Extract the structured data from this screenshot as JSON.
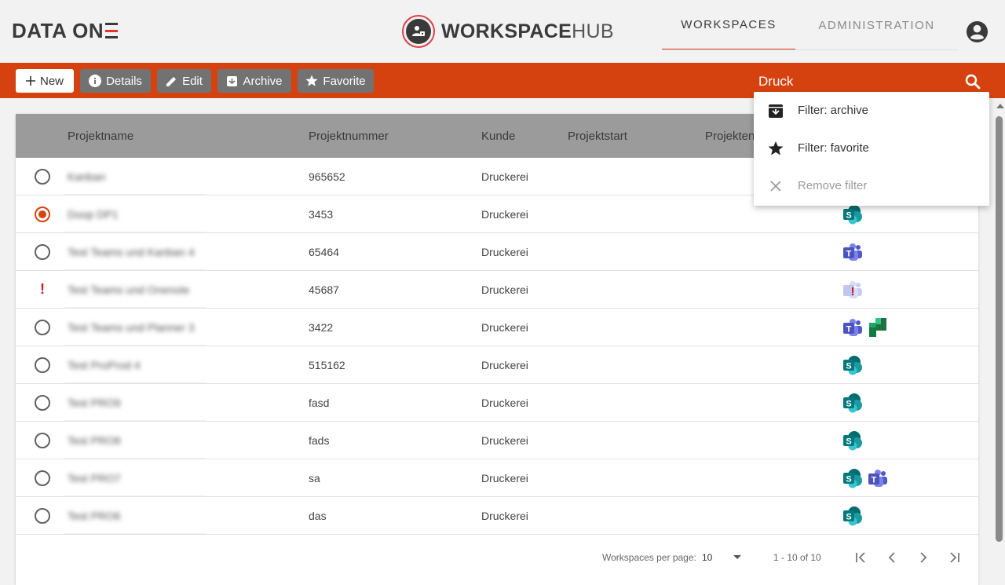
{
  "header": {
    "brand": "DATA ON",
    "logo_text": "WORKSPACE",
    "logo_text_hub": "HUB",
    "nav_tabs": [
      {
        "label": "WORKSPACES",
        "active": true
      },
      {
        "label": "ADMINISTRATION",
        "active": false
      }
    ]
  },
  "toolbar": {
    "new_label": "New",
    "details_label": "Details",
    "edit_label": "Edit",
    "archive_label": "Archive",
    "favorite_label": "Favorite",
    "search_value": "Druck"
  },
  "dropdown": {
    "items": [
      {
        "label": "Filter: archive",
        "icon": "archive-icon"
      },
      {
        "label": "Filter: favorite",
        "icon": "star-icon"
      },
      {
        "label": "Remove filter",
        "icon": "close-icon",
        "disabled": true
      }
    ]
  },
  "table": {
    "headers": [
      "Projektname",
      "Projektnummer",
      "Kunde",
      "Projektstart",
      "Projektende"
    ],
    "rows": [
      {
        "name": "Kanban",
        "number": "965652",
        "customer": "Druckerei",
        "state": "unselected",
        "apps": []
      },
      {
        "name": "Doop DP1",
        "number": "3453",
        "customer": "Druckerei",
        "state": "selected",
        "apps": [
          "sharepoint-icon"
        ]
      },
      {
        "name": "Test Teams und Kanban 4",
        "number": "65464",
        "customer": "Druckerei",
        "state": "unselected",
        "apps": [
          "teams-icon"
        ]
      },
      {
        "name": "Test Teams und Onenote",
        "number": "45687",
        "customer": "Druckerei",
        "state": "warning",
        "apps": [
          "teams-warning-icon"
        ]
      },
      {
        "name": "Test Teams und Planner 3",
        "number": "3422",
        "customer": "Druckerei",
        "state": "unselected",
        "apps": [
          "teams-icon",
          "planner-icon"
        ]
      },
      {
        "name": "Test ProProd 4",
        "number": "515162",
        "customer": "Druckerei",
        "state": "unselected",
        "apps": [
          "sharepoint-icon"
        ]
      },
      {
        "name": "Test PRO9",
        "number": "fasd",
        "customer": "Druckerei",
        "state": "unselected",
        "apps": [
          "sharepoint-icon"
        ]
      },
      {
        "name": "Test PRO8",
        "number": "fads",
        "customer": "Druckerei",
        "state": "unselected",
        "apps": [
          "sharepoint-icon"
        ]
      },
      {
        "name": "Test PRO7",
        "number": "sa",
        "customer": "Druckerei",
        "state": "unselected",
        "apps": [
          "sharepoint-icon",
          "teams-icon"
        ]
      },
      {
        "name": "Test PRO6",
        "number": "das",
        "customer": "Druckerei",
        "state": "unselected",
        "apps": [
          "sharepoint-icon"
        ]
      }
    ]
  },
  "footer": {
    "per_page_label": "Workspaces per page:",
    "per_page_value": "10",
    "range_label": "1 - 10 of 10"
  },
  "colors": {
    "accent": "#d6420f",
    "toolbar_button": "#727272",
    "table_header": "#9b9b9b",
    "warning": "#d41515"
  }
}
